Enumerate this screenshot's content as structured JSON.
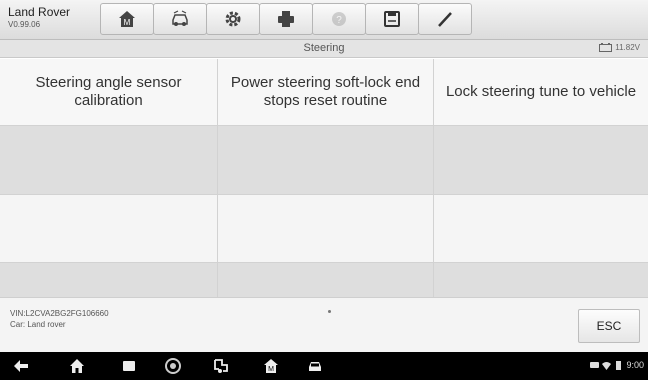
{
  "header": {
    "brand": "Land Rover",
    "version": "V0.99.06",
    "toolbar": [
      {
        "icon": "home-icon"
      },
      {
        "icon": "vehicle-swap-icon"
      },
      {
        "icon": "settings-icon"
      },
      {
        "icon": "print-icon"
      },
      {
        "icon": "help-icon",
        "disabled": true
      },
      {
        "icon": "save-icon"
      },
      {
        "icon": "pen-icon"
      }
    ]
  },
  "subheader": {
    "title": "Steering",
    "battery": "11.82V"
  },
  "functions": [
    "Steering angle sensor calibration",
    "Power steering soft-lock end stops reset routine",
    "Lock steering tune to vehicle"
  ],
  "footer": {
    "vin": "VIN:L2CVA2BG2FG106660",
    "car": "Car: Land rover",
    "esc_label": "ESC"
  },
  "statusbar": {
    "time": "9:00"
  },
  "colors": {
    "topbar": "#e6e6e6",
    "row_alt": "#dedede",
    "navbar": "#000000"
  }
}
